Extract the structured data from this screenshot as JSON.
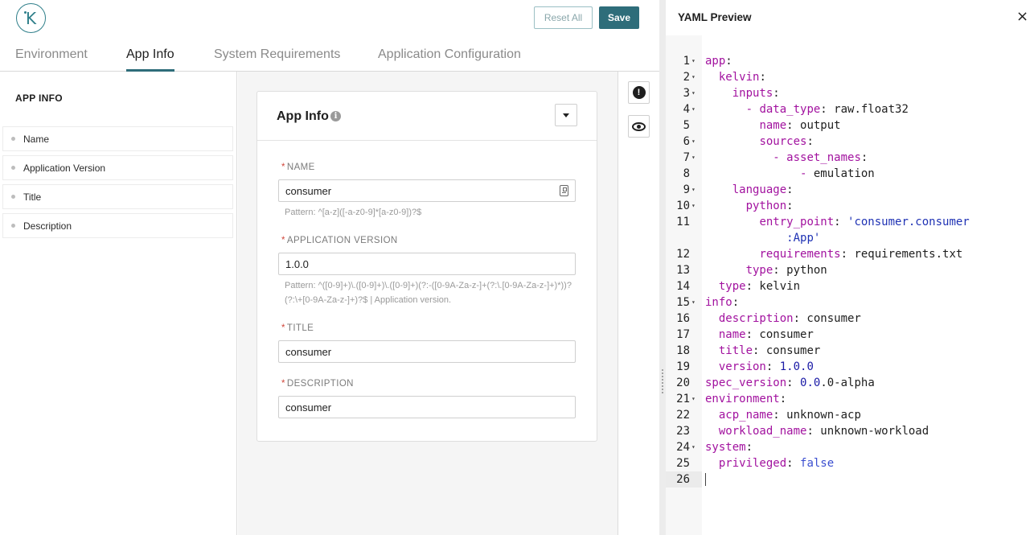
{
  "logo": {
    "letter": "K"
  },
  "toolbar": {
    "reset_label": "Reset All",
    "save_label": "Save"
  },
  "tabs": [
    {
      "label": "Environment",
      "active": false
    },
    {
      "label": "App Info",
      "active": true
    },
    {
      "label": "System Requirements",
      "active": false
    },
    {
      "label": "Application Configuration",
      "active": false
    }
  ],
  "sidebar": {
    "heading": "APP INFO",
    "items": [
      {
        "label": "Name"
      },
      {
        "label": "Application Version"
      },
      {
        "label": "Title"
      },
      {
        "label": "Description"
      }
    ]
  },
  "card": {
    "title": "App Info",
    "info_icon": "i",
    "fields": {
      "name": {
        "label": "NAME",
        "value": "consumer",
        "hint": "Pattern: ^[a-z]([-a-z0-9]*[a-z0-9])?$"
      },
      "version": {
        "label": "APPLICATION VERSION",
        "value": "1.0.0",
        "hint_1": "Pattern: ^([0-9]+)\\.([0-9]+)\\.([0-9]+)(?:-([0-9A-Za-z-]+(?:\\.[0-9A-Za-z-]+)*))?",
        "hint_2": "(?:\\+[0-9A-Za-z-]+)?$ | Application version."
      },
      "title": {
        "label": "TITLE",
        "value": "consumer"
      },
      "description": {
        "label": "DESCRIPTION",
        "value": "consumer"
      }
    }
  },
  "rail": {
    "warning_icon": "!",
    "preview_icon": "eye-icon"
  },
  "yaml_preview": {
    "title": "YAML Preview",
    "close_icon": "×",
    "lines": [
      {
        "n": "1",
        "fold": true,
        "code": "app:"
      },
      {
        "n": "2",
        "fold": true,
        "code": "  kelvin:"
      },
      {
        "n": "3",
        "fold": true,
        "code": "    inputs:"
      },
      {
        "n": "4",
        "fold": true,
        "code": "      - data_type: raw.float32"
      },
      {
        "n": "5",
        "fold": false,
        "code": "        name: output"
      },
      {
        "n": "6",
        "fold": true,
        "code": "        sources:"
      },
      {
        "n": "7",
        "fold": true,
        "code": "          - asset_names:"
      },
      {
        "n": "8",
        "fold": false,
        "code": "              - emulation"
      },
      {
        "n": "9",
        "fold": true,
        "code": "    language:"
      },
      {
        "n": "10",
        "fold": true,
        "code": "      python:"
      },
      {
        "n": "11",
        "fold": false,
        "code": "        entry_point: 'consumer.consumer"
      },
      {
        "n": "",
        "fold": false,
        "code": "            :App'"
      },
      {
        "n": "12",
        "fold": false,
        "code": "        requirements: requirements.txt"
      },
      {
        "n": "13",
        "fold": false,
        "code": "      type: python"
      },
      {
        "n": "14",
        "fold": false,
        "code": "  type: kelvin"
      },
      {
        "n": "15",
        "fold": true,
        "code": "info:"
      },
      {
        "n": "16",
        "fold": false,
        "code": "  description: consumer"
      },
      {
        "n": "17",
        "fold": false,
        "code": "  name: consumer"
      },
      {
        "n": "18",
        "fold": false,
        "code": "  title: consumer"
      },
      {
        "n": "19",
        "fold": false,
        "code": "  version: 1.0.0"
      },
      {
        "n": "20",
        "fold": false,
        "code": "spec_version: 0.0.0-alpha"
      },
      {
        "n": "21",
        "fold": true,
        "code": "environment:"
      },
      {
        "n": "22",
        "fold": false,
        "code": "  acp_name: unknown-acp"
      },
      {
        "n": "23",
        "fold": false,
        "code": "  workload_name: unknown-workload"
      },
      {
        "n": "24",
        "fold": true,
        "code": "system:"
      },
      {
        "n": "25",
        "fold": false,
        "code": "  privileged: false"
      },
      {
        "n": "26",
        "fold": false,
        "code": "",
        "active": true
      }
    ]
  },
  "colors": {
    "accent": "#2e6d7a",
    "yaml_key": "#a2129f",
    "yaml_string": "#1f32b4"
  }
}
